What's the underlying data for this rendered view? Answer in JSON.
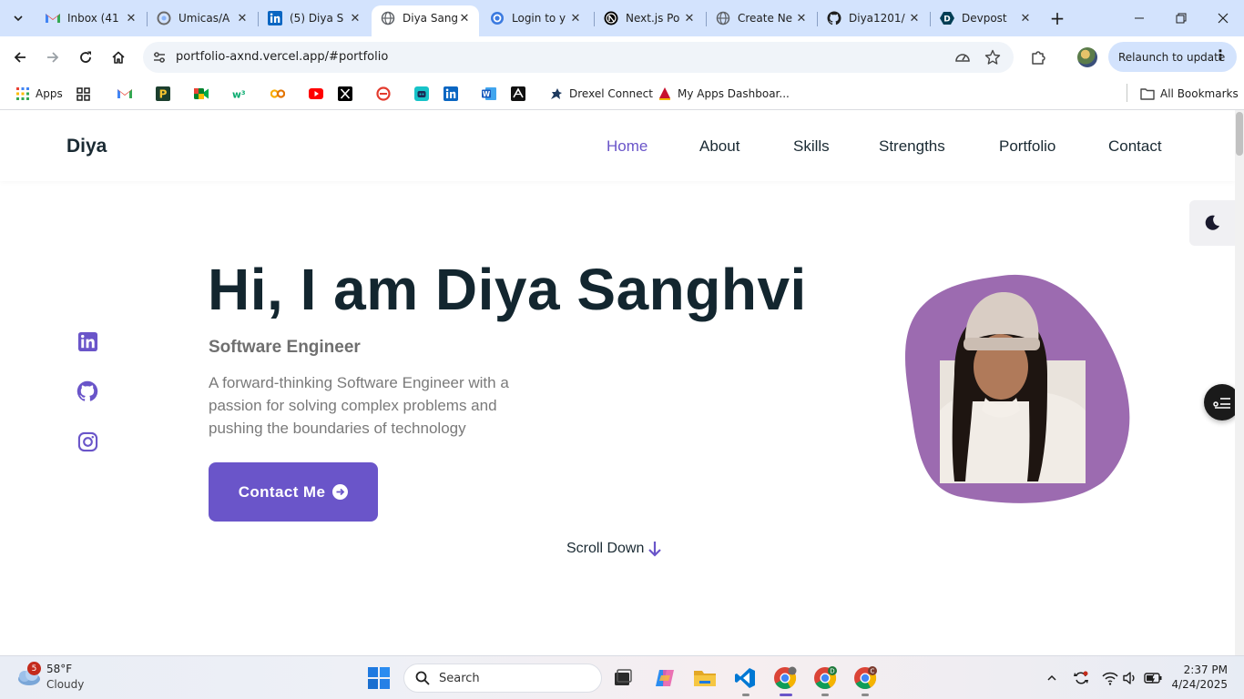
{
  "browser": {
    "tabs": [
      {
        "title": "Inbox (41",
        "icon": "gmail-icon"
      },
      {
        "title": "Umicas/A",
        "icon": "umicas-icon"
      },
      {
        "title": "(5) Diya S",
        "icon": "linkedin-icon"
      },
      {
        "title": "Diya Sang",
        "icon": "globe-icon",
        "active": true
      },
      {
        "title": "Login to y",
        "icon": "login-icon"
      },
      {
        "title": "Next.js Po",
        "icon": "nextjs-icon"
      },
      {
        "title": "Create Ne",
        "icon": "globe-icon"
      },
      {
        "title": "Diya1201/",
        "icon": "github-icon"
      },
      {
        "title": "Devpost",
        "icon": "devpost-icon"
      }
    ],
    "url": "portfolio-axnd.vercel.app/#portfolio",
    "relaunch_label": "Relaunch to update",
    "bookmarks": [
      {
        "label": "Apps",
        "icon": "apps-icon"
      },
      {
        "label": "",
        "icon": "grid-icon"
      },
      {
        "label": "",
        "icon": "gmail-icon"
      },
      {
        "label": "",
        "icon": "p-icon"
      },
      {
        "label": "",
        "icon": "meet-icon"
      },
      {
        "label": "",
        "icon": "w3schools-icon"
      },
      {
        "label": "",
        "icon": "co-icon"
      },
      {
        "label": "",
        "icon": "youtube-icon"
      },
      {
        "label": "",
        "icon": "x-icon"
      },
      {
        "label": "",
        "icon": "red-circle-icon"
      },
      {
        "label": "",
        "icon": "bot-icon"
      },
      {
        "label": "",
        "icon": "linkedin-icon"
      },
      {
        "label": "",
        "icon": "word-icon"
      },
      {
        "label": "",
        "icon": "vector-icon"
      },
      {
        "label": "Drexel Connect",
        "icon": "dragon-icon"
      },
      {
        "label": "My Apps Dashboar...",
        "icon": "drexel-icon"
      }
    ],
    "all_bookmarks_label": "All Bookmarks"
  },
  "site": {
    "logo": "Diya",
    "nav": [
      "Home",
      "About",
      "Skills",
      "Strengths",
      "Portfolio",
      "Contact"
    ],
    "active_nav": "Home",
    "hero_title": "Hi, I am Diya Sanghvi",
    "hero_subtitle": "Software Engineer",
    "hero_description": "A forward-thinking Software Engineer with a passion for solving complex problems and pushing the boundaries of technology",
    "contact_button": "Contact Me",
    "scroll_down": "Scroll Down",
    "accent_color": "#6a55c9",
    "social": [
      "linkedin-icon",
      "github-icon",
      "instagram-icon"
    ]
  },
  "taskbar": {
    "weather_temp": "58°F",
    "weather_desc": "Cloudy",
    "weather_badge": "5",
    "search_placeholder": "Search",
    "time": "2:37 PM",
    "date": "4/24/2025"
  }
}
